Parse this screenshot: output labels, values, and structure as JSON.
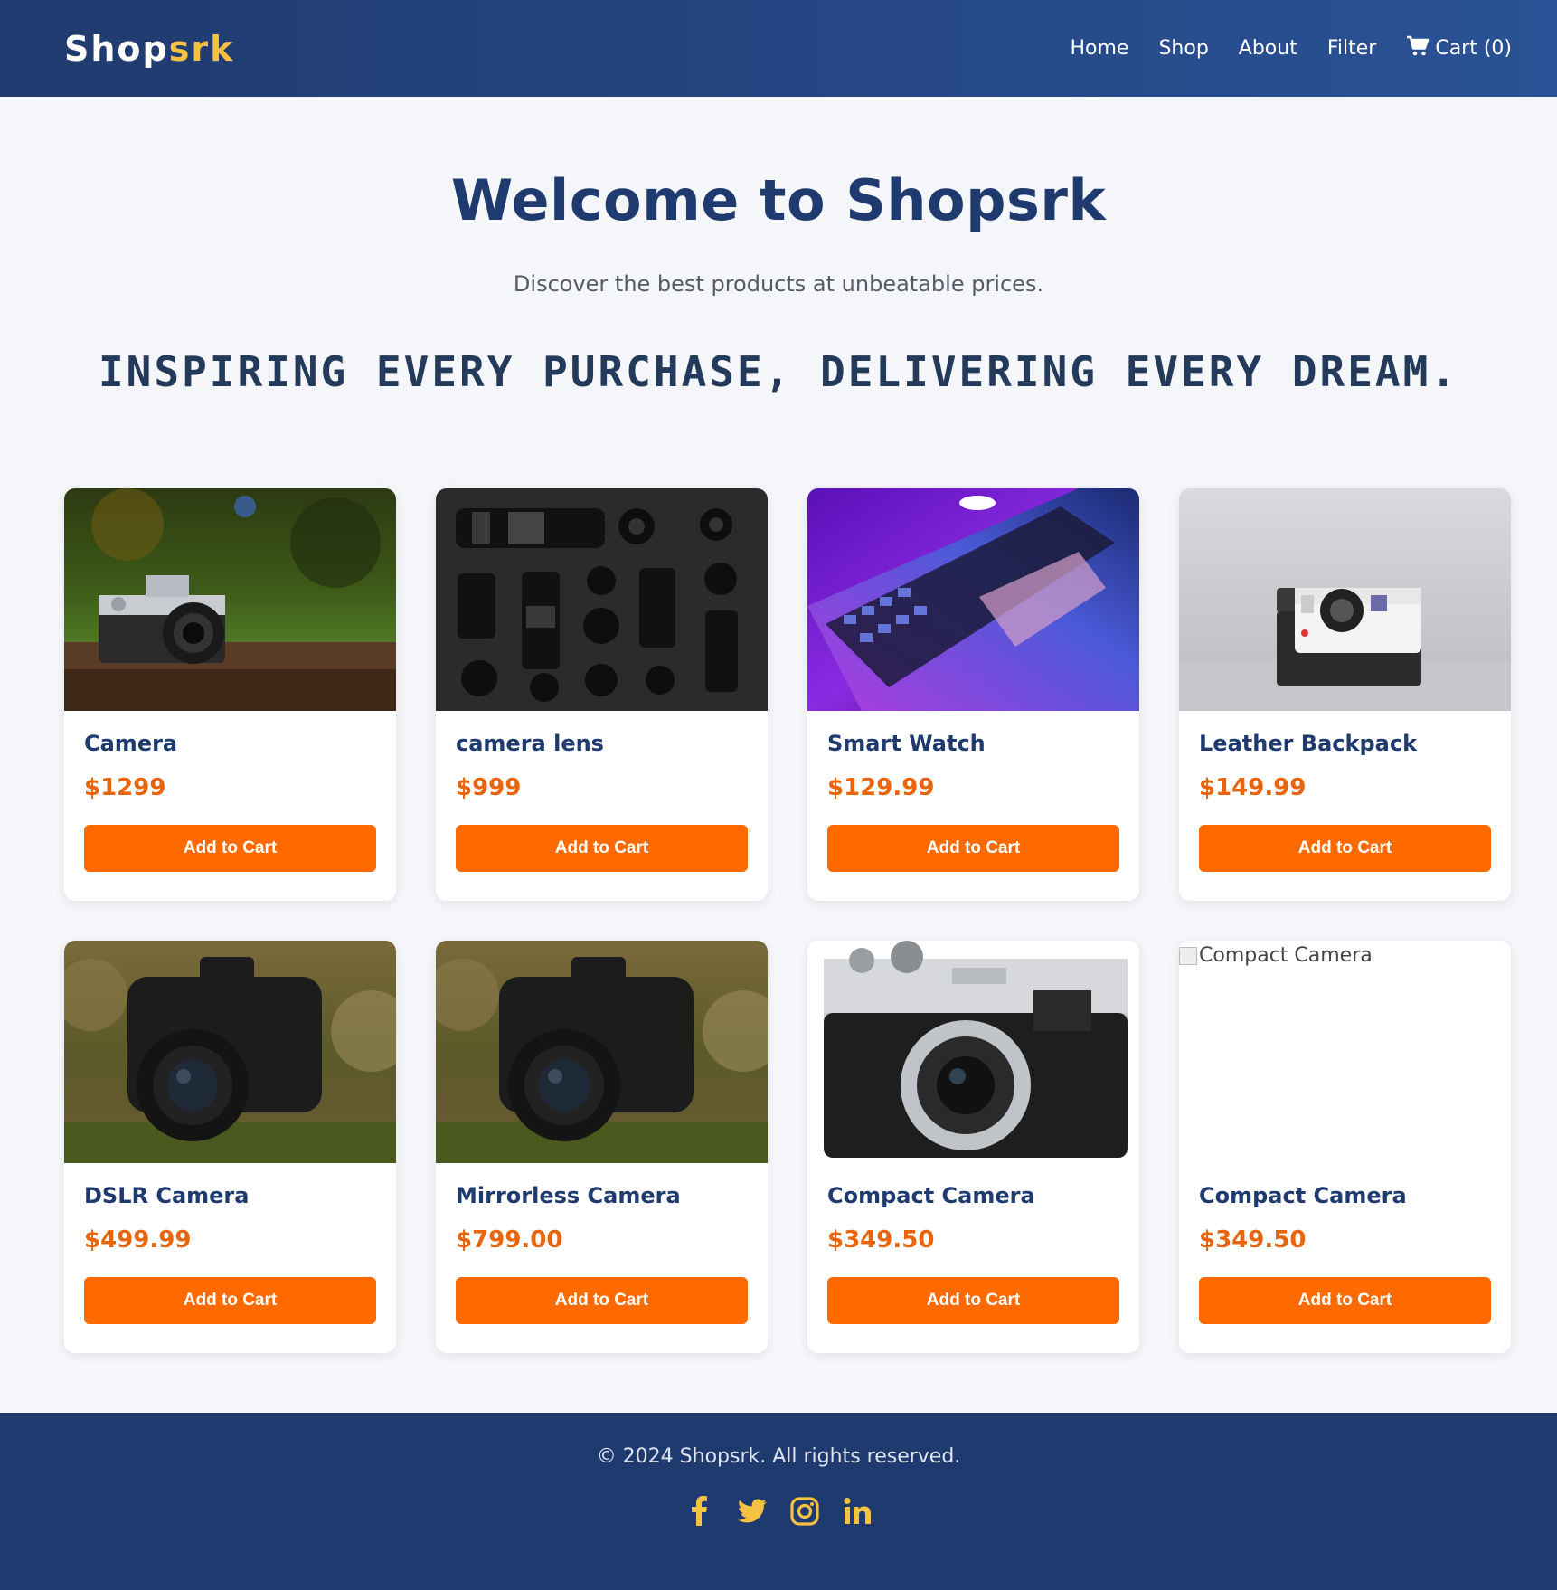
{
  "brand": {
    "name_main": "Shop",
    "name_accent": "srk",
    "accent_color": "#f5c242",
    "primary_color": "#1f3a6e",
    "button_color": "#ff6a00"
  },
  "nav": {
    "items": [
      "Home",
      "Shop",
      "About",
      "Filter"
    ],
    "cart_label": "Cart (0)",
    "cart_icon": "shopping-cart-icon"
  },
  "hero": {
    "title": "Welcome to Shopsrk",
    "subtitle": "Discover the best products at unbeatable prices.",
    "tagline": "INSPIRING EVERY PURCHASE, DELIVERING EVERY DREAM."
  },
  "products": [
    {
      "name": "Camera",
      "price": "$1299",
      "button": "Add to Cart",
      "image": "vintage-film-camera-photo"
    },
    {
      "name": "camera lens",
      "price": "$999",
      "button": "Add to Cart",
      "image": "camera-lenses-flatlay-photo"
    },
    {
      "name": "Smart Watch",
      "price": "$129.99",
      "button": "Add to Cart",
      "image": "laptop-purple-light-photo"
    },
    {
      "name": "Leather Backpack",
      "price": "$149.99",
      "button": "Add to Cart",
      "image": "instant-camera-photo"
    },
    {
      "name": "DSLR Camera",
      "price": "$499.99",
      "button": "Add to Cart",
      "image": "canon-dslr-photo"
    },
    {
      "name": "Mirrorless Camera",
      "price": "$799.00",
      "button": "Add to Cart",
      "image": "canon-dslr-photo"
    },
    {
      "name": "Compact Camera",
      "price": "$349.50",
      "button": "Add to Cart",
      "image": "compact-silver-camera-photo"
    },
    {
      "name": "Compact Camera",
      "price": "$349.50",
      "button": "Add to Cart",
      "image": "broken-image",
      "alt": "Compact Camera"
    }
  ],
  "footer": {
    "copyright": "© 2024 Shopsrk. All rights reserved.",
    "socials": [
      "facebook-icon",
      "twitter-icon",
      "instagram-icon",
      "linkedin-icon"
    ]
  }
}
